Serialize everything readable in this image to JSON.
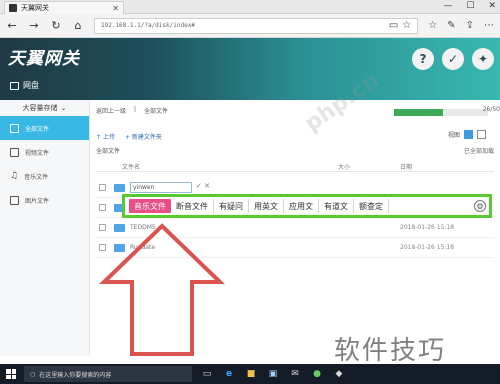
{
  "browser": {
    "tab_title": "天翼网关",
    "url": "192.168.1.1/?a/disk/index#",
    "window_controls": [
      "—",
      "☐",
      "✕"
    ]
  },
  "app": {
    "logo_text": "天翼网关",
    "section": "网盘",
    "header_icons": [
      "help-icon",
      "settings-icon",
      "tools-icon"
    ]
  },
  "sidebar": {
    "header": "大容量存储",
    "items": [
      {
        "label": "全部文件",
        "icon": "file-icon",
        "active": true
      },
      {
        "label": "视频文件",
        "icon": "video-icon",
        "active": false
      },
      {
        "label": "音乐文件",
        "icon": "music-icon",
        "active": false
      },
      {
        "label": "图片文件",
        "icon": "image-icon",
        "active": false
      }
    ]
  },
  "main": {
    "back": "返回上一级",
    "all": "全部文件",
    "quota_value": "26/50",
    "quota_fraction": 0.52,
    "upload": "上传",
    "new_folder": "新建文件夹",
    "path": "全部文件",
    "loaded_text": "已全部加载",
    "view_label": "视图",
    "columns": {
      "name": "文件名",
      "size": "大小",
      "date": "日期"
    },
    "rows": [
      {
        "name": "yinwen",
        "date": "",
        "editing": true
      },
      {
        "name": "",
        "date": "",
        "editing": false
      },
      {
        "name": "TEDDM5",
        "date": "2018-01-26 15:18",
        "editing": false
      },
      {
        "name": "Rupdate",
        "date": "2018-01-26 15:18",
        "editing": false
      }
    ]
  },
  "suggestions": {
    "items": [
      "音乐文件",
      "断音文件",
      "有疑问",
      "用英文",
      "应用文",
      "有道文",
      "额查定"
    ],
    "active_index": 0,
    "highlight_color": "#58c930",
    "active_color": "#e84f88"
  },
  "watermark": {
    "center": "php.cn",
    "bottom": "软件技巧"
  },
  "taskbar": {
    "search_placeholder": "在这里输入你要搜索的内容"
  },
  "annotation": {
    "arrow_color": "#d9534f"
  }
}
